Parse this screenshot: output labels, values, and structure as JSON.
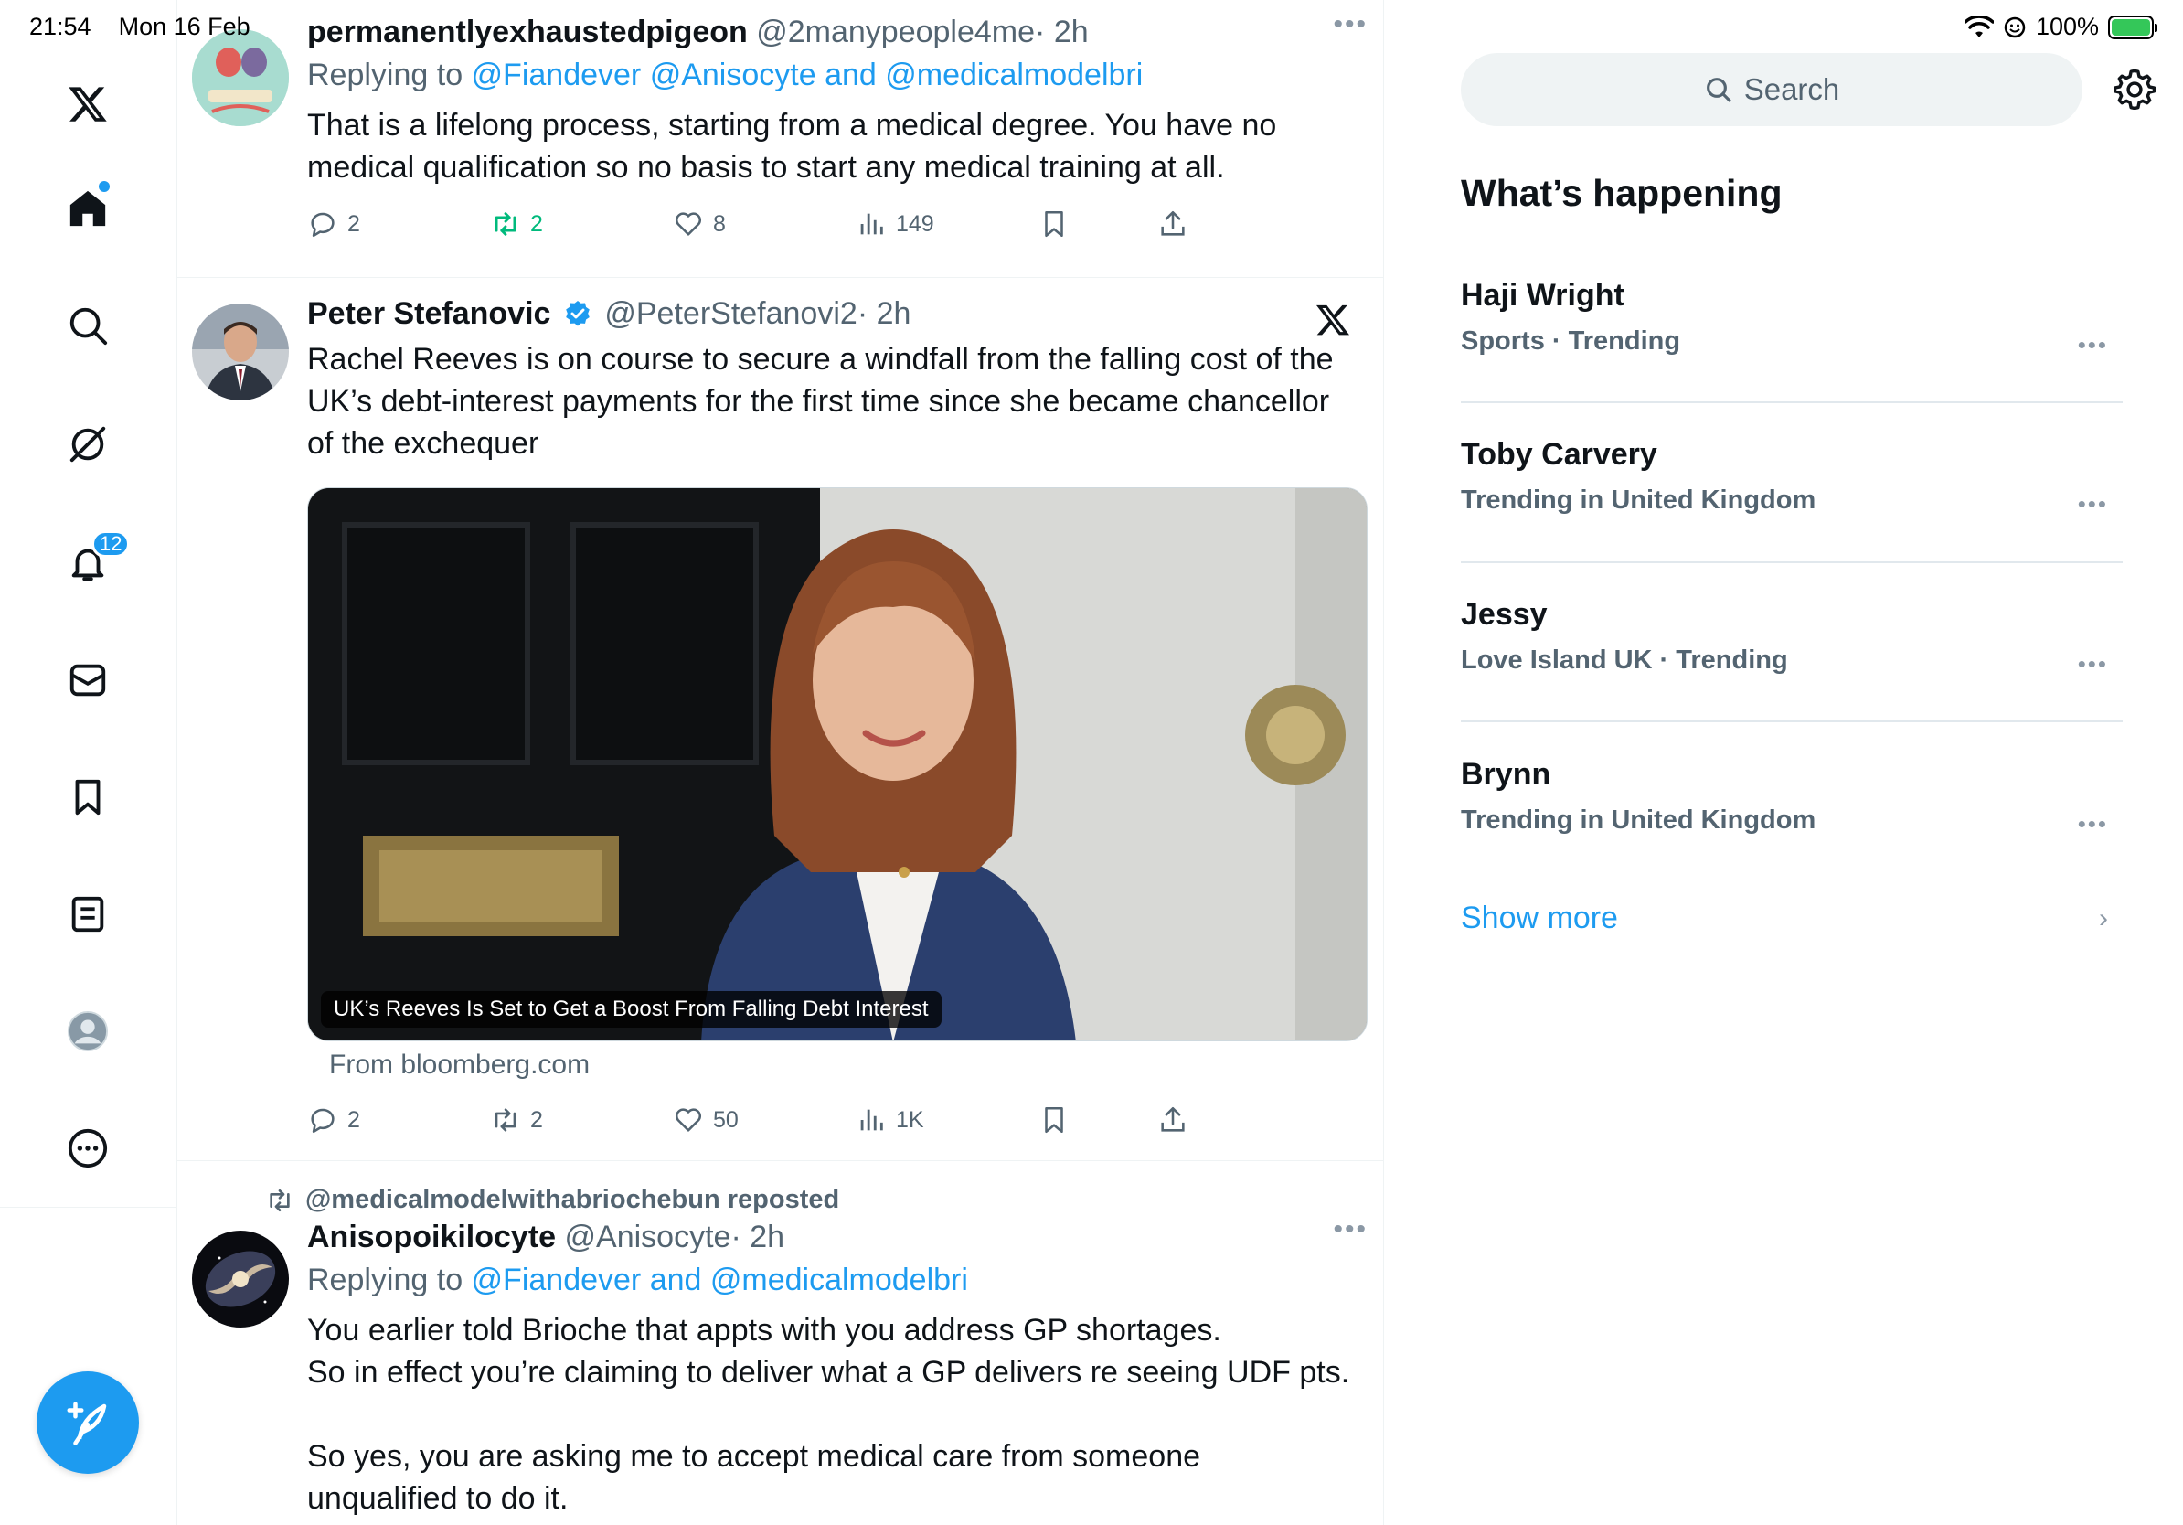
{
  "status_bar": {
    "time": "21:54",
    "date": "Mon 16 Feb",
    "battery": "100%"
  },
  "nav": {
    "items": [
      {
        "name": "x-logo-icon"
      },
      {
        "name": "home-icon"
      },
      {
        "name": "search-icon"
      },
      {
        "name": "grok-icon"
      },
      {
        "name": "notifications-icon"
      },
      {
        "name": "messages-icon"
      },
      {
        "name": "bookmarks-icon"
      },
      {
        "name": "lists-icon"
      },
      {
        "name": "profile-icon"
      },
      {
        "name": "more-icon"
      }
    ],
    "notification_count": "12"
  },
  "feed": {
    "tweets": [
      {
        "name": "permanentlyexhaustedpigeon",
        "handle": "@2manypeople4me",
        "time": "· 2h",
        "reply_prefix": "Replying to ",
        "reply_mentions": "@Fiandever @Anisocyte and @medicalmodelbri",
        "text": "That is a lifelong process, starting from a medical degree. You have no medical qualification so no basis to start any medical training at all.",
        "replies": "2",
        "reposts": "2",
        "likes": "8",
        "views": "149"
      },
      {
        "name": "Peter Stefanovic",
        "handle": "@PeterStefanovi2",
        "time": "· 2h",
        "text": "Rachel Reeves is on course to secure a windfall from the falling cost of the UK’s debt-interest payments for the first time since she became chancellor of the exchequer",
        "media_caption": "UK’s Reeves Is Set to Get a Boost From Falling Debt Interest",
        "from_link": "From bloomberg.com",
        "replies": "2",
        "reposts": "2",
        "likes": "50",
        "views": "1K"
      },
      {
        "repost_label": "@medicalmodelwithabriochebun reposted",
        "name": "Anisopoikilocyte",
        "handle": "@Anisocyte",
        "time": "· 2h",
        "reply_prefix": "Replying to ",
        "reply_mentions": "@Fiandever and @medicalmodelbri",
        "text": "You earlier told Brioche that appts with you address GP shortages.\nSo in effect you’re claiming to deliver what a GP delivers re seeing UDF pts.\n\nSo yes, you are asking me to accept medical care from someone unqualified to do it."
      }
    ]
  },
  "sidebar": {
    "search_placeholder": "Search",
    "trends_title": "What’s happening",
    "trends": [
      {
        "name": "Haji Wright",
        "meta": "Sports · Trending"
      },
      {
        "name": "Toby Carvery",
        "meta": "Trending in United Kingdom"
      },
      {
        "name": "Jessy",
        "meta": "Love Island UK · Trending"
      },
      {
        "name": "Brynn",
        "meta": "Trending in United Kingdom"
      }
    ],
    "show_more": "Show more"
  },
  "colors": {
    "accent": "#1d9bf0",
    "secondary_text": "#536471",
    "repost_green": "#00ba7c"
  }
}
